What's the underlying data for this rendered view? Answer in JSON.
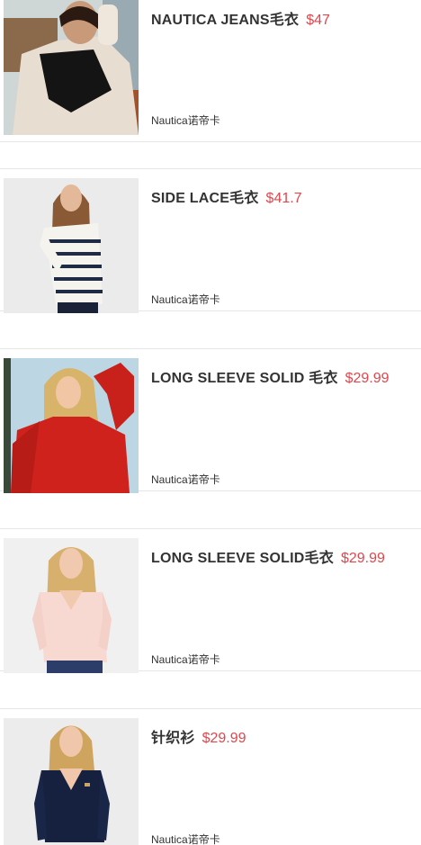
{
  "products": [
    {
      "title": "NAUTICA JEANS毛衣",
      "price": "$47",
      "brand": "Nautica诺帝卡"
    },
    {
      "title": "SIDE LACE毛衣",
      "price": "$41.7",
      "brand": "Nautica诺帝卡"
    },
    {
      "title": "LONG SLEEVE SOLID 毛衣",
      "price": "$29.99",
      "brand": "Nautica诺帝卡"
    },
    {
      "title": "LONG SLEEVE SOLID毛衣",
      "price": "$29.99",
      "brand": "Nautica诺帝卡"
    },
    {
      "title": "针织衫",
      "price": "$29.99",
      "brand": "Nautica诺帝卡"
    }
  ],
  "colors": {
    "price": "#e0474c",
    "title": "#333333",
    "divider": "#e6e6e6"
  }
}
